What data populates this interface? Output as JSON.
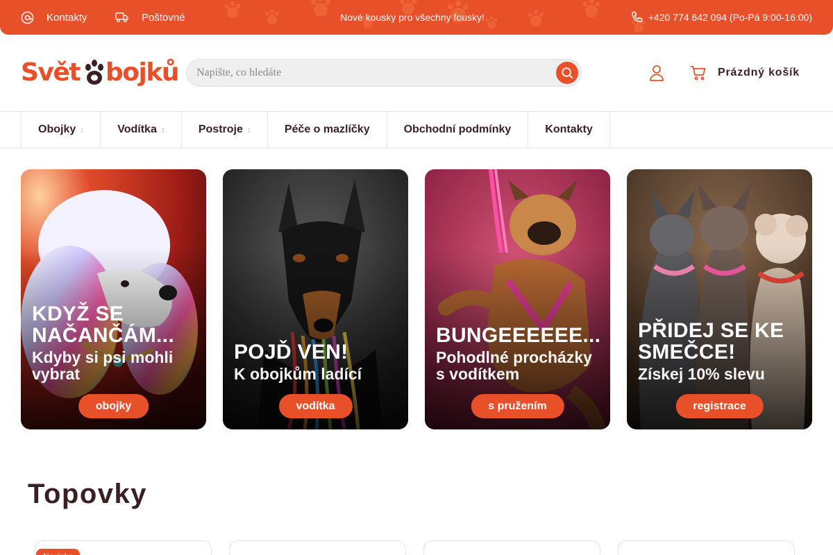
{
  "topbar": {
    "contacts_label": "Kontakty",
    "shipping_label": "Poštovné",
    "slogan": "Nové kousky pro všechny fousky!",
    "phone": "+420 774 642 094 (Po-Pá 9:00-16:00)"
  },
  "header": {
    "logo_left": "Svět",
    "logo_right": "bojků",
    "search_placeholder": "Napište, co hledáte",
    "cart_label": "Prázdný košík"
  },
  "nav": {
    "items": [
      {
        "label": "Obojky"
      },
      {
        "label": "Vodítka"
      },
      {
        "label": "Postroje"
      },
      {
        "label": "Péče o mazlíčky"
      },
      {
        "label": "Obchodní podmínky"
      },
      {
        "label": "Kontakty"
      }
    ]
  },
  "banners": [
    {
      "title": "KDYŽ SE NAČANČÁM...",
      "subtitle": "Kdyby si psi mohli vybrat",
      "cta": "obojky"
    },
    {
      "title": "POJĎ VEN!",
      "subtitle": "K obojkům ladící",
      "cta": "vodítka"
    },
    {
      "title": "BUNGEEEEEE...",
      "subtitle": "Pohodlné procházky s vodítkem",
      "cta": "s pružením"
    },
    {
      "title": "PŘIDEJ SE KE SMEČCE!",
      "subtitle": "Získej 10% slevu",
      "cta": "registrace"
    }
  ],
  "section": {
    "title": "Topovky",
    "badge": "Novinka"
  },
  "colors": {
    "accent": "#e8502a",
    "text_dark": "#3a1f24"
  },
  "icons": [
    "at-icon",
    "truck-icon",
    "phone-icon",
    "search-icon",
    "user-icon",
    "cart-icon",
    "paw-icon"
  ]
}
